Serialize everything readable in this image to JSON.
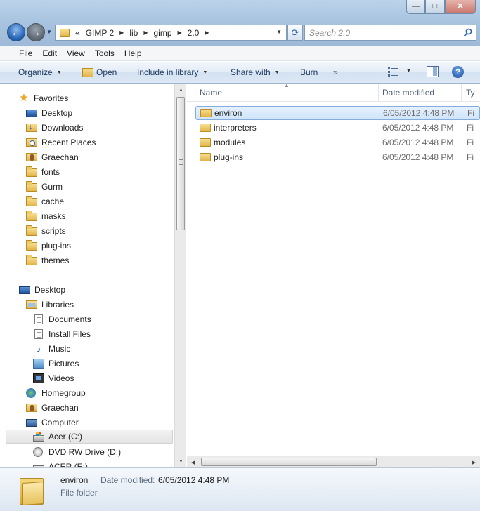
{
  "window": {
    "minimize_glyph": "—",
    "maximize_glyph": "□",
    "close_glyph": "✕"
  },
  "navigation": {
    "back_icon": "back-arrow-icon",
    "forward_icon": "forward-arrow-icon",
    "breadcrumb_lead": "«",
    "breadcrumbs": [
      "GIMP 2",
      "lib",
      "gimp",
      "2.0"
    ],
    "search_placeholder": "Search 2.0"
  },
  "menubar": {
    "items": [
      "File",
      "Edit",
      "View",
      "Tools",
      "Help"
    ]
  },
  "toolbar": {
    "organize": "Organize",
    "open": "Open",
    "include_in_library": "Include in library",
    "share_with": "Share with",
    "burn": "Burn",
    "more": "»",
    "help": "?"
  },
  "nav_pane": {
    "favorites": {
      "label": "Favorites",
      "items": [
        "Desktop",
        "Downloads",
        "Recent Places",
        "Graechan",
        "fonts",
        "Gurm",
        "cache",
        "masks",
        "scripts",
        "plug-ins",
        "themes"
      ]
    },
    "desktop": {
      "label": "Desktop",
      "libraries": "Libraries",
      "library_items": [
        "Documents",
        "Install Files",
        "Music",
        "Pictures",
        "Videos"
      ],
      "homegroup": "Homegroup",
      "user": "Graechan",
      "computer": "Computer",
      "drives": [
        "Acer (C:)",
        "DVD RW Drive (D:)",
        "ACER (E:)"
      ]
    }
  },
  "file_list": {
    "columns": {
      "name": "Name",
      "date_modified": "Date modified",
      "type": "Ty"
    },
    "rows": [
      {
        "name": "environ",
        "date": "6/05/2012 4:48 PM",
        "type": "Fi",
        "selected": true
      },
      {
        "name": "interpreters",
        "date": "6/05/2012 4:48 PM",
        "type": "Fi",
        "selected": false
      },
      {
        "name": "modules",
        "date": "6/05/2012 4:48 PM",
        "type": "Fi",
        "selected": false
      },
      {
        "name": "plug-ins",
        "date": "6/05/2012 4:48 PM",
        "type": "Fi",
        "selected": false
      }
    ]
  },
  "details": {
    "name": "environ",
    "type": "File folder",
    "date_label": "Date modified:",
    "date_value": "6/05/2012 4:48 PM"
  }
}
